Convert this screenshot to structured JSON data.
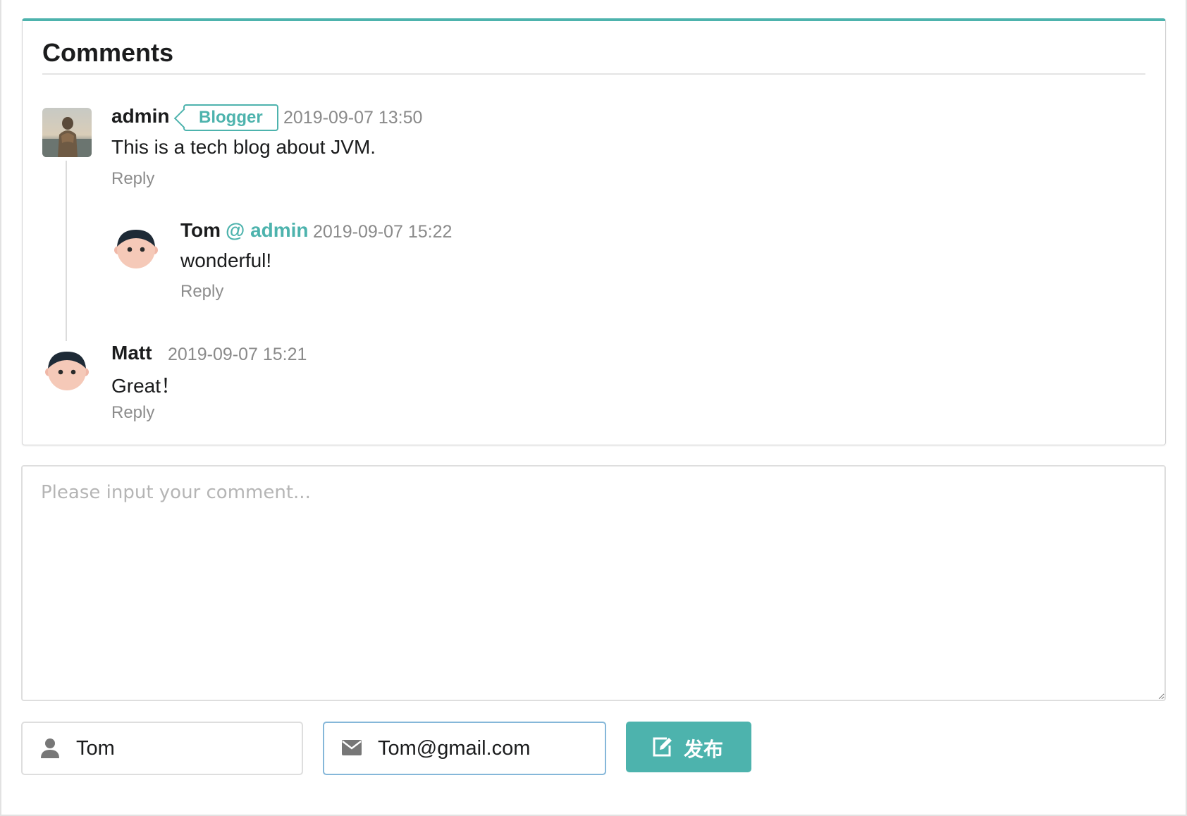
{
  "comments": {
    "title": "Comments",
    "items": [
      {
        "author": "admin",
        "badge": "Blogger",
        "timestamp": "2019-09-07 13:50",
        "text": "This is a tech blog about JVM.",
        "reply_label": "Reply",
        "avatar": "photo-avatar",
        "replies": [
          {
            "author": "Tom",
            "mention": "@ admin",
            "timestamp": "2019-09-07 15:22",
            "text": "wonderful!",
            "reply_label": "Reply",
            "avatar": "cartoon-face-avatar"
          }
        ]
      },
      {
        "author": "Matt",
        "timestamp": "2019-09-07 15:21",
        "text": "Great！",
        "reply_label": "Reply",
        "avatar": "cartoon-face-avatar"
      }
    ]
  },
  "form": {
    "comment_placeholder": "Please input your comment...",
    "comment_value": "",
    "name_value": "Tom",
    "email_value": "Tom@gmail.com",
    "submit_label": "发布",
    "icons": {
      "name": "user-icon",
      "email": "envelope-icon",
      "submit": "edit-icon"
    }
  },
  "colors": {
    "accent": "#4db3ad",
    "text": "#1b1c1d",
    "muted": "#8a8a8a",
    "border": "#dedede"
  }
}
